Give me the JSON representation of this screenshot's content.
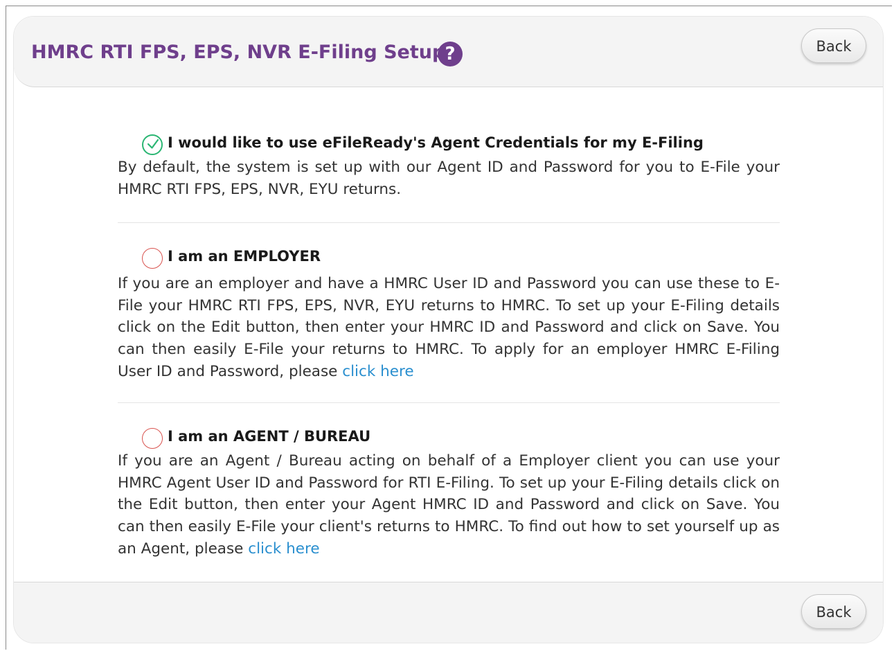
{
  "header": {
    "title": "HMRC RTI FPS, EPS, NVR E-Filing Setup",
    "help_icon": "?",
    "back_label": "Back"
  },
  "footer": {
    "back_label": "Back"
  },
  "options": [
    {
      "title": "I would like to use eFileReady's Agent Credentials for my E-Filing",
      "selected": true,
      "description": "By default, the system is set up with our Agent ID and Password for you to E-File your HMRC RTI FPS, EPS, NVR, EYU returns.",
      "link_label": ""
    },
    {
      "title": "I am an EMPLOYER",
      "selected": false,
      "description": "If you are an employer and have a HMRC User ID and Password you can use these to E-File your HMRC RTI FPS, EPS, NVR, EYU returns to HMRC. To set up your E-Filing details click on the Edit button, then enter your HMRC ID and Password and click on Save. You can then easily E-File your returns to HMRC. To apply for an employer HMRC E-Filing User ID and Password, please",
      "link_label": "click here"
    },
    {
      "title": "I am an AGENT / BUREAU",
      "selected": false,
      "description": "If you are an Agent / Bureau acting on behalf of a Employer client you can use your HMRC Agent User ID and Password for RTI E-Filing. To set up your E-Filing details click on the Edit button, then enter your Agent HMRC ID and Password and click on Save. You can then easily E-File your client's returns to HMRC. To find out how to set yourself up as an Agent, please",
      "link_label": "click here"
    }
  ],
  "colors": {
    "title": "#6f3f8c",
    "link": "#2a8fcf",
    "radio_checked": "#2bb673",
    "radio_unchecked": "#d9534f"
  }
}
